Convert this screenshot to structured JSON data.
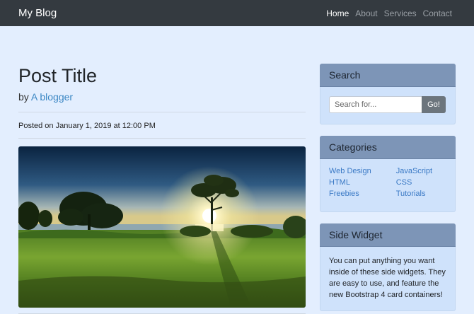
{
  "navbar": {
    "brand": "My Blog",
    "links": [
      "Home",
      "About",
      "Services",
      "Contact"
    ]
  },
  "post": {
    "title": "Post Title",
    "by_prefix": "by",
    "author": "A blogger",
    "posted_on": "Posted on January 1, 2019 at 12:00 PM"
  },
  "sidebar": {
    "search": {
      "header": "Search",
      "placeholder": "Search for...",
      "button": "Go!"
    },
    "categories": {
      "header": "Categories",
      "left": [
        "Web Design",
        "HTML",
        "Freebies"
      ],
      "right": [
        "JavaScript",
        "CSS",
        "Tutorials"
      ]
    },
    "widget": {
      "header": "Side Widget",
      "text": "You can put anything you want inside of these side widgets. They are easy to use, and feature the new Bootstrap 4 card containers!"
    }
  },
  "colors": {
    "navbar": "#343a40",
    "page_background": "#e3eefe",
    "card_header": "#7d95b7",
    "card_body": "#cfe2fb",
    "link": "#3a79c5",
    "button": "#6c757d"
  }
}
